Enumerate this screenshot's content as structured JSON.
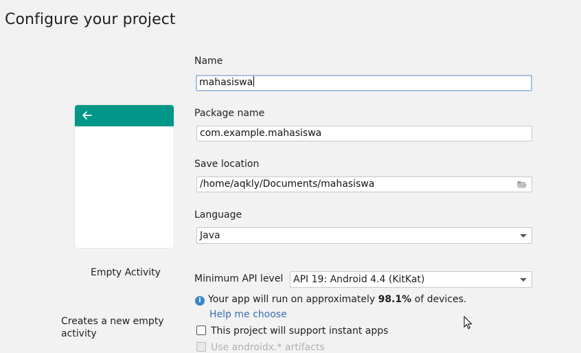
{
  "header": {
    "title": "Configure your project"
  },
  "template": {
    "name": "Empty Activity",
    "description": "Creates a new empty activity",
    "preview_accent_color": "#009688",
    "back_icon": "arrow-left-icon"
  },
  "form": {
    "name_label": "Name",
    "name_value": "mahasiswa",
    "package_label": "Package name",
    "package_value": "com.example.mahasiswa",
    "location_label": "Save location",
    "location_value": "/home/aqkly/Documents/mahasiswa",
    "location_icon": "folder-open-icon",
    "language_label": "Language",
    "language_value": "Java",
    "api_label": "Minimum API level",
    "api_value": "API 19: Android 4.4 (KitKat)",
    "info_prefix": "Your app will run on approximately ",
    "info_percent": "98.1%",
    "info_suffix": " of devices.",
    "help_link": "Help me choose",
    "instant_apps_label": "This project will support instant apps",
    "androidx_label": "Use androidx.* artifacts"
  }
}
